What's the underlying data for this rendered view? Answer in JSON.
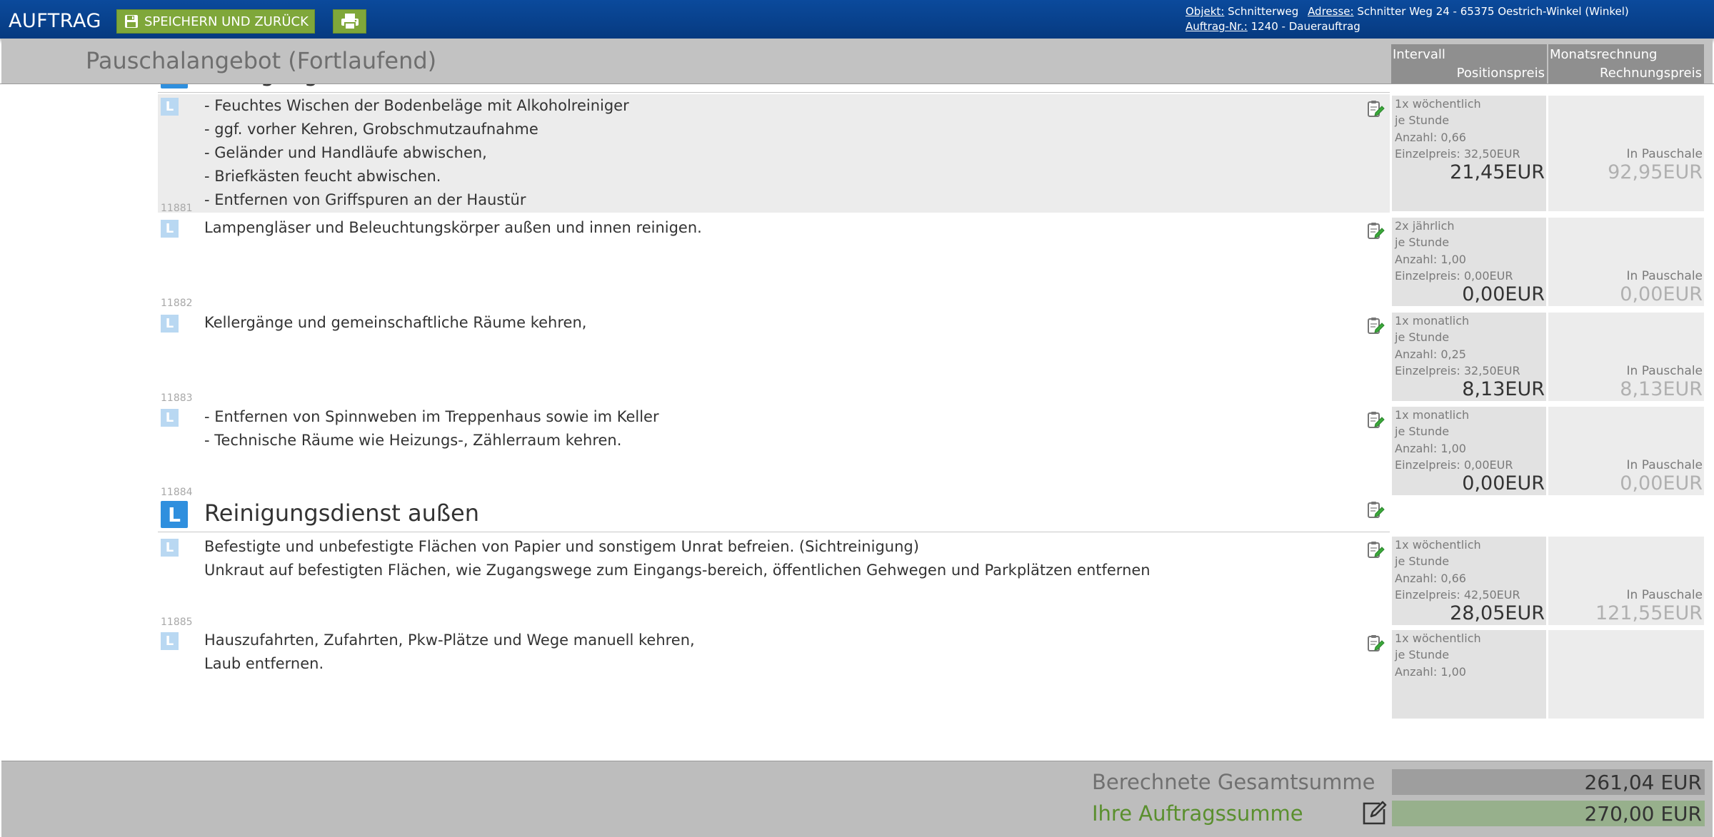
{
  "topbar": {
    "title": "AUFTRAG",
    "save_label": "SPEICHERN UND ZURÜCK",
    "info": {
      "objekt_key": "Objekt:",
      "objekt_val": "Schnitterweg",
      "adresse_key": "Adresse:",
      "adresse_val": "Schnitter Weg 24  -  65375 Oestrich-Winkel (Winkel)",
      "auftrag_key": "Auftrag-Nr.:",
      "auftrag_val": "1240  -  Dauerauftrag"
    }
  },
  "header": {
    "title": "Pauschalangebot (Fortlaufend)",
    "col1_top": "Intervall",
    "col1_bottom": "Positionspreis",
    "col2_top": "Monatsrechnung",
    "col2_bottom": "Rechnungspreis"
  },
  "section_badge": "L",
  "row_badge": "L",
  "sections": [
    {
      "title": "Reinigungsdienst innen",
      "rows": [
        {
          "id": "11881",
          "lines": [
            "- Feuchtes Wischen der Bodenbeläge mit Alkoholreiniger",
            "- ggf. vorher Kehren, Grobschmutzaufnahme",
            "- Geländer und Handläufe abwischen,",
            "- Briefkästen feucht abwischen.",
            "- Entfernen von Griffspuren an der Haustür"
          ],
          "interval": "1x wöchentlich",
          "unit": "je Stunde",
          "anzahl": "Anzahl: 0,66",
          "einzelpreis": "Einzelpreis: 32,50EUR",
          "position_price": "21,45EUR",
          "billing_label": "In Pauschale",
          "billing_price": "92,95EUR"
        },
        {
          "id": "11882",
          "lines": [
            "Lampengläser und Beleuchtungskörper außen und innen reinigen."
          ],
          "interval": "2x jährlich",
          "unit": "je Stunde",
          "anzahl": "Anzahl: 1,00",
          "einzelpreis": "Einzelpreis: 0,00EUR",
          "position_price": "0,00EUR",
          "billing_label": "In Pauschale",
          "billing_price": "0,00EUR"
        },
        {
          "id": "11883",
          "lines": [
            "Kellergänge und gemeinschaftliche Räume kehren,"
          ],
          "interval": "1x monatlich",
          "unit": "je Stunde",
          "anzahl": "Anzahl: 0,25",
          "einzelpreis": "Einzelpreis: 32,50EUR",
          "position_price": "8,13EUR",
          "billing_label": "In Pauschale",
          "billing_price": "8,13EUR"
        },
        {
          "id": "11884",
          "lines": [
            "- Entfernen von Spinnweben im Treppenhaus sowie im Keller",
            "- Technische Räume wie Heizungs-, Zählerraum kehren."
          ],
          "interval": "1x monatlich",
          "unit": "je Stunde",
          "anzahl": "Anzahl: 1,00",
          "einzelpreis": "Einzelpreis: 0,00EUR",
          "position_price": "0,00EUR",
          "billing_label": "In Pauschale",
          "billing_price": "0,00EUR"
        }
      ]
    },
    {
      "title": "Reinigungsdienst außen",
      "rows": [
        {
          "id": "11885",
          "lines": [
            "Befestigte und unbefestigte Flächen von Papier und sonstigem Unrat befreien. (Sichtreinigung)",
            "Unkraut auf befestigten Flächen, wie Zugangswege zum Eingangs-bereich, öffentlichen Gehwegen und Parkplätzen entfernen"
          ],
          "interval": "1x wöchentlich",
          "unit": "je Stunde",
          "anzahl": "Anzahl: 0,66",
          "einzelpreis": "Einzelpreis: 42,50EUR",
          "position_price": "28,05EUR",
          "billing_label": "In Pauschale",
          "billing_price": "121,55EUR"
        },
        {
          "id": "",
          "lines": [
            "Hauszufahrten, Zufahrten, Pkw-Plätze und Wege manuell kehren,",
            "Laub entfernen."
          ],
          "interval": "1x wöchentlich",
          "unit": "je Stunde",
          "anzahl": "Anzahl: 1,00",
          "einzelpreis": "",
          "position_price": "",
          "billing_label": "",
          "billing_price": ""
        }
      ]
    }
  ],
  "footer": {
    "calc_label": "Berechnete Gesamtsumme",
    "calc_value": "261,04 EUR",
    "order_label": "Ihre Auftragssumme",
    "order_value": "270,00 EUR"
  },
  "colors": {
    "topbar": "#0b4a9c",
    "button_green": "#7fa73a",
    "section_badge": "#2f8fde",
    "row_badge": "#b9d8f2",
    "order_green": "#5a8f2e"
  }
}
